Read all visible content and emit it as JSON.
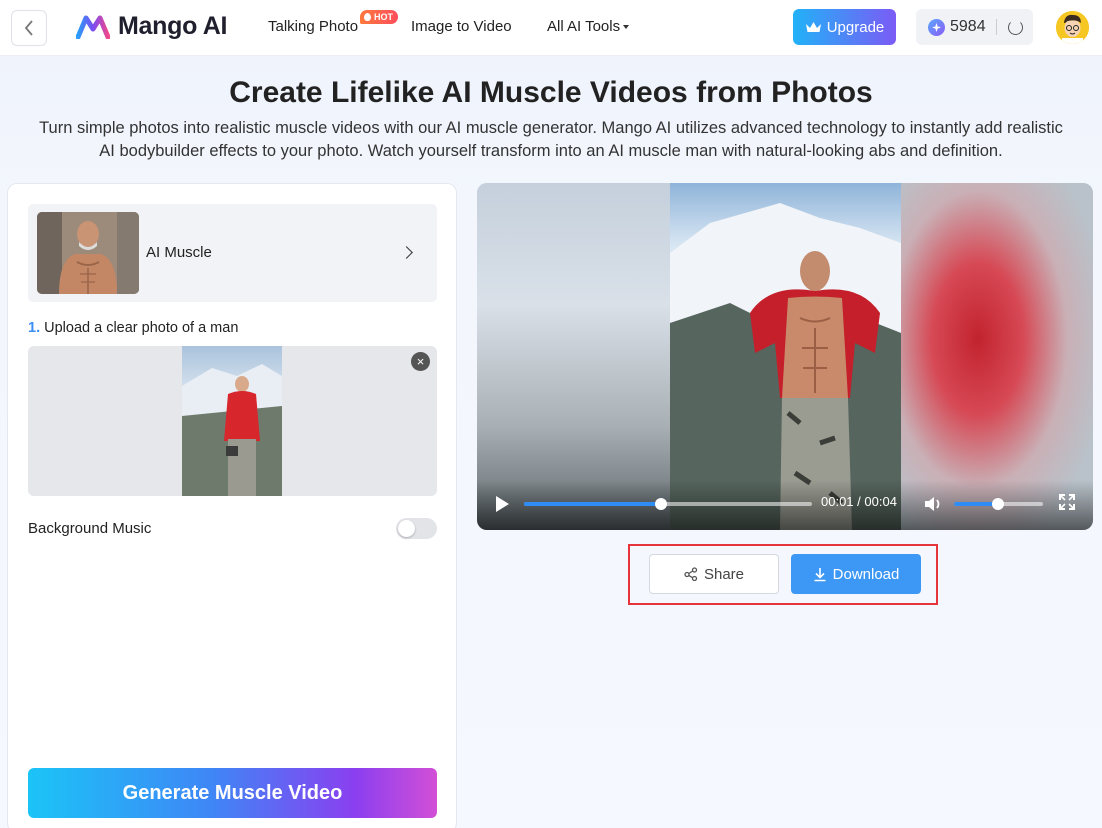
{
  "header": {
    "brand": "Mango AI",
    "nav": [
      {
        "label": "Talking Photo",
        "badge": "HOT"
      },
      {
        "label": "Image to Video"
      },
      {
        "label": "All AI Tools"
      }
    ],
    "upgrade_label": "Upgrade",
    "credits": "5984",
    "icons": [
      "back-icon",
      "crown-icon",
      "credit-icon",
      "refresh-icon"
    ]
  },
  "hero": {
    "title": "Create Lifelike AI Muscle Videos from Photos",
    "subtitle_line1": "Turn simple photos into realistic muscle videos with our AI muscle generator. Mango AI utilizes advanced technology to instantly add realistic",
    "subtitle_line2": "AI bodybuilder effects to your photo. Watch yourself transform into an AI muscle man with natural-looking abs and definition."
  },
  "left_panel": {
    "effect_name": "AI Muscle",
    "step_number": "1.",
    "step_text": " Upload a clear photo of a man",
    "background_music_label": "Background Music",
    "background_music_on": false,
    "generate_label": "Generate Muscle Video"
  },
  "video": {
    "current_time": "00:01",
    "separator": "/",
    "duration": "00:04",
    "progress": 0.476,
    "volume": 0.49
  },
  "actions": {
    "share_label": "Share",
    "download_label": "Download"
  },
  "colors": {
    "accent": "#3d97f5",
    "highlight_border": "#e5343a",
    "hot_badge": "#ff5a4a"
  }
}
